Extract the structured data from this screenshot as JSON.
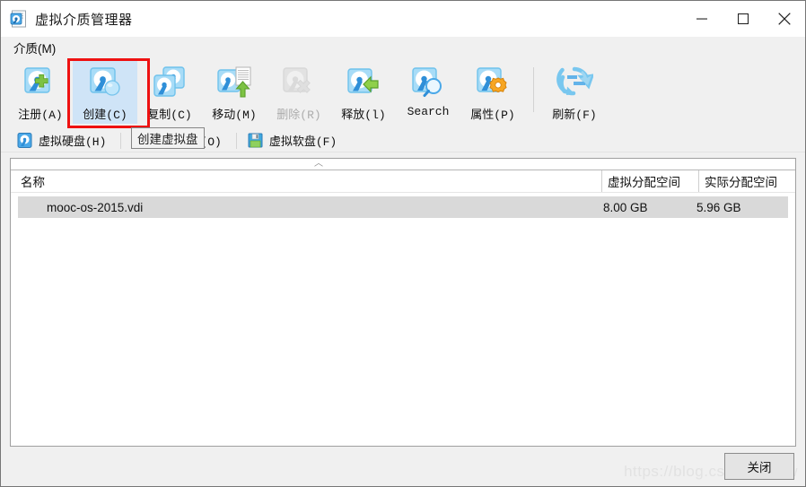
{
  "window": {
    "title": "虚拟介质管理器",
    "app_icon": "virtual-media-manager-icon",
    "controls": {
      "minimize": "minimize-icon",
      "maximize": "maximize-icon",
      "close": "close-icon"
    }
  },
  "menubar": {
    "items": [
      {
        "label": "介质(M)",
        "name": "menu-media"
      }
    ]
  },
  "toolbar": {
    "items": [
      {
        "label": "注册(A)",
        "icon": "hdd-add-icon",
        "state": "normal",
        "name": "toolbar-register"
      },
      {
        "label": "创建(C)",
        "icon": "hdd-create-icon",
        "state": "hover",
        "name": "toolbar-create"
      },
      {
        "label": "复制(C)",
        "icon": "hdd-copy-icon",
        "state": "normal",
        "name": "toolbar-copy"
      },
      {
        "label": "移动(M)",
        "icon": "hdd-move-icon",
        "state": "normal",
        "name": "toolbar-move"
      },
      {
        "label": "删除(R)",
        "icon": "hdd-delete-icon",
        "state": "disabled",
        "name": "toolbar-delete"
      },
      {
        "label": "释放(l)",
        "icon": "hdd-release-icon",
        "state": "normal",
        "name": "toolbar-release"
      },
      {
        "label": "Search",
        "icon": "hdd-search-icon",
        "state": "normal",
        "name": "toolbar-search"
      },
      {
        "label": "属性(P)",
        "icon": "hdd-properties-icon",
        "state": "normal",
        "name": "toolbar-properties"
      },
      {
        "label": "刷新(F)",
        "icon": "refresh-icon",
        "state": "normal",
        "name": "toolbar-refresh"
      }
    ],
    "separator_before_index": 8
  },
  "tooltip": {
    "text": "创建虚拟盘",
    "target": "toolbar-create"
  },
  "annotation": {
    "color": "#ee1111",
    "target": "toolbar-create"
  },
  "tabs": [
    {
      "label": "虚拟硬盘(H)",
      "icon": "hard-disk-icon",
      "selected": true,
      "name": "tab-hard-disks"
    },
    {
      "label": "虚拟光盘(O)",
      "icon": "optical-disk-icon",
      "selected": false,
      "name": "tab-optical-disks"
    },
    {
      "label": "虚拟软盘(F)",
      "icon": "floppy-disk-icon",
      "selected": false,
      "name": "tab-floppy-disks"
    }
  ],
  "list": {
    "sort_indicator": "︿",
    "columns": [
      {
        "label": "名称",
        "name": "column-name"
      },
      {
        "label": "虚拟分配空间",
        "name": "column-virtual-size"
      },
      {
        "label": "实际分配空间",
        "name": "column-actual-size"
      }
    ],
    "rows": [
      {
        "name": "mooc-os-2015.vdi",
        "virtual_size": "8.00 GB",
        "actual_size": "5.96 GB",
        "selected": true
      }
    ]
  },
  "bottom": {
    "close_label": "关闭",
    "watermark": "https://blog.csdn.net/jxw"
  },
  "colors": {
    "window_bg": "#f0f0f0",
    "titlebar_bg": "#ffffff",
    "hover_blue": "#cfe4f7",
    "selection_gray": "#d9d9d9",
    "accent_red": "#ee1111",
    "icon_blue": "#2f8fd8",
    "icon_green": "#77bb33"
  }
}
